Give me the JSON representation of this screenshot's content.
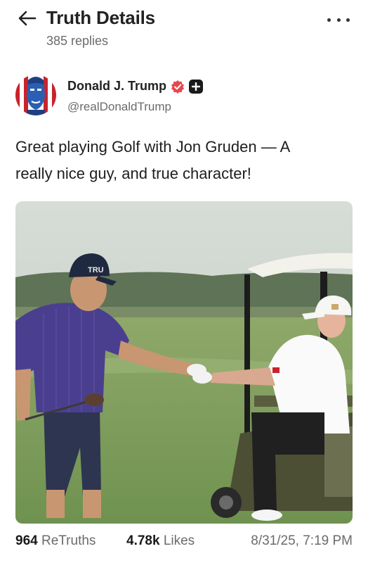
{
  "header": {
    "title": "Truth Details",
    "reply_count": "385 replies",
    "back_icon": "arrow-left-icon",
    "more_icon": "more-horizontal-icon"
  },
  "author": {
    "display_name": "Donald J. Trump",
    "handle": "@realDonaldTrump",
    "verified_color": "#e5484d"
  },
  "post": {
    "text_line1": "Great playing Golf with Jon Gruden — A",
    "text_line2": "really nice guy, and true character!",
    "media_cap_text": "TRU"
  },
  "stats": {
    "retruths_count": "964",
    "retruths_label": "ReTruths",
    "likes_count": "4.78k",
    "likes_label": "Likes",
    "timestamp": "8/31/25, 7:19 PM"
  }
}
